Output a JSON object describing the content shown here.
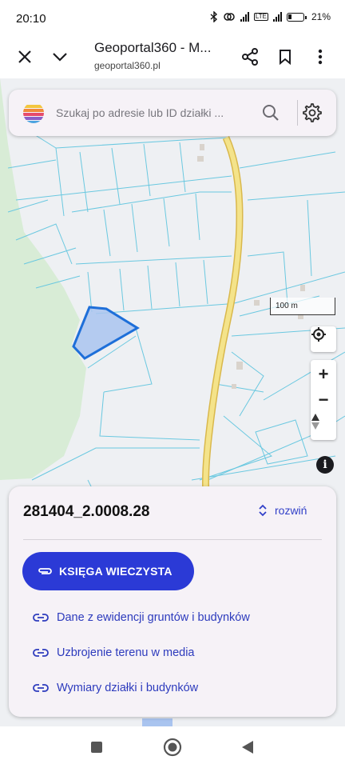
{
  "status_bar": {
    "time": "20:10",
    "network": "LTE",
    "battery": "21%"
  },
  "browser": {
    "title": "Geoportal360 - M...",
    "url": "geoportal360.pl",
    "icons": [
      "close-icon",
      "chevron-down-icon",
      "share-icon",
      "bookmark-icon",
      "more-vert-icon"
    ]
  },
  "search": {
    "placeholder": "Szukaj po adresie lub ID działki ..."
  },
  "map": {
    "scale_label": "100 m",
    "controls": {
      "zoom_in": "+",
      "zoom_out": "−",
      "info": "i"
    },
    "colors": {
      "background": "#eef0f3",
      "forest": "#d8ecd6",
      "parcel_lines": "#6ac8e0",
      "road": "#f4e38a",
      "selected_parcel_fill": "#a9c4ef",
      "selected_parcel_stroke": "#1e6fd9"
    }
  },
  "card": {
    "parcel_id": "281404_2.0008.28",
    "expand_label": "rozwiń",
    "primary_button": "KSIĘGA WIECZYSTA",
    "links": [
      "Dane z ewidencji gruntów i budynków",
      "Uzbrojenie terenu w media",
      "Wymiary działki i budynków"
    ],
    "accent_color": "#2b3ad6"
  }
}
